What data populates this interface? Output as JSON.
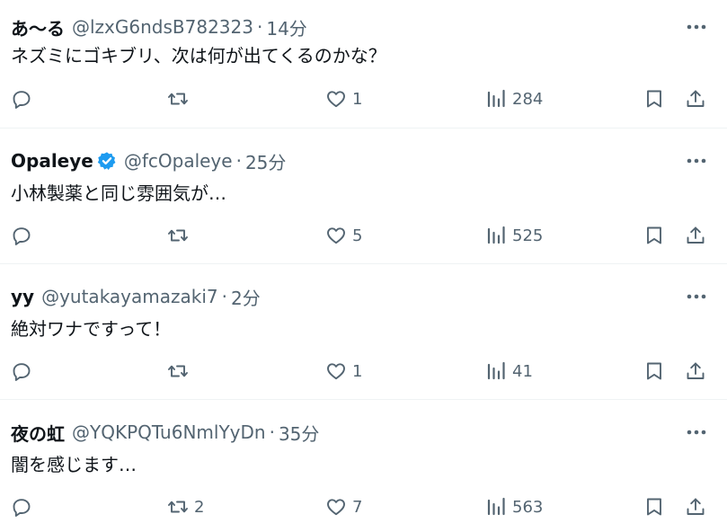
{
  "colors": {
    "text": "#0f1419",
    "secondary": "#536471",
    "divider": "#eff3f4",
    "verified": "#1d9bf0"
  },
  "separator": "·",
  "posts": [
    {
      "name": "あ〜る",
      "handle": "@lzxG6ndsB782323",
      "time": "14分",
      "verified": false,
      "text": "ネズミにゴキブリ、次は何が出てくるのかな？",
      "replies": "",
      "reposts": "",
      "likes": "1",
      "views": "284"
    },
    {
      "name": "Opaleye",
      "handle": "@fcOpaleye",
      "time": "25分",
      "verified": true,
      "text": "小林製薬と同じ雰囲気が…",
      "replies": "",
      "reposts": "",
      "likes": "5",
      "views": "525"
    },
    {
      "name": "yy",
      "handle": "@yutakayamazaki7",
      "time": "2分",
      "verified": false,
      "text": "絶対ワナですって！",
      "replies": "",
      "reposts": "",
      "likes": "1",
      "views": "41"
    },
    {
      "name": "夜の虹",
      "handle": "@YQKPQTu6NmlYyDn",
      "time": "35分",
      "verified": false,
      "text": "闇を感じます…",
      "replies": "",
      "reposts": "2",
      "likes": "7",
      "views": "563"
    }
  ],
  "icons": {
    "more": "more-horizontal-icon",
    "reply": "reply-bubble-icon",
    "repost": "repost-arrows-icon",
    "like": "heart-icon",
    "views": "views-bar-chart-icon",
    "bookmark": "bookmark-icon",
    "share": "share-upload-icon",
    "verified": "verified-badge-icon"
  }
}
